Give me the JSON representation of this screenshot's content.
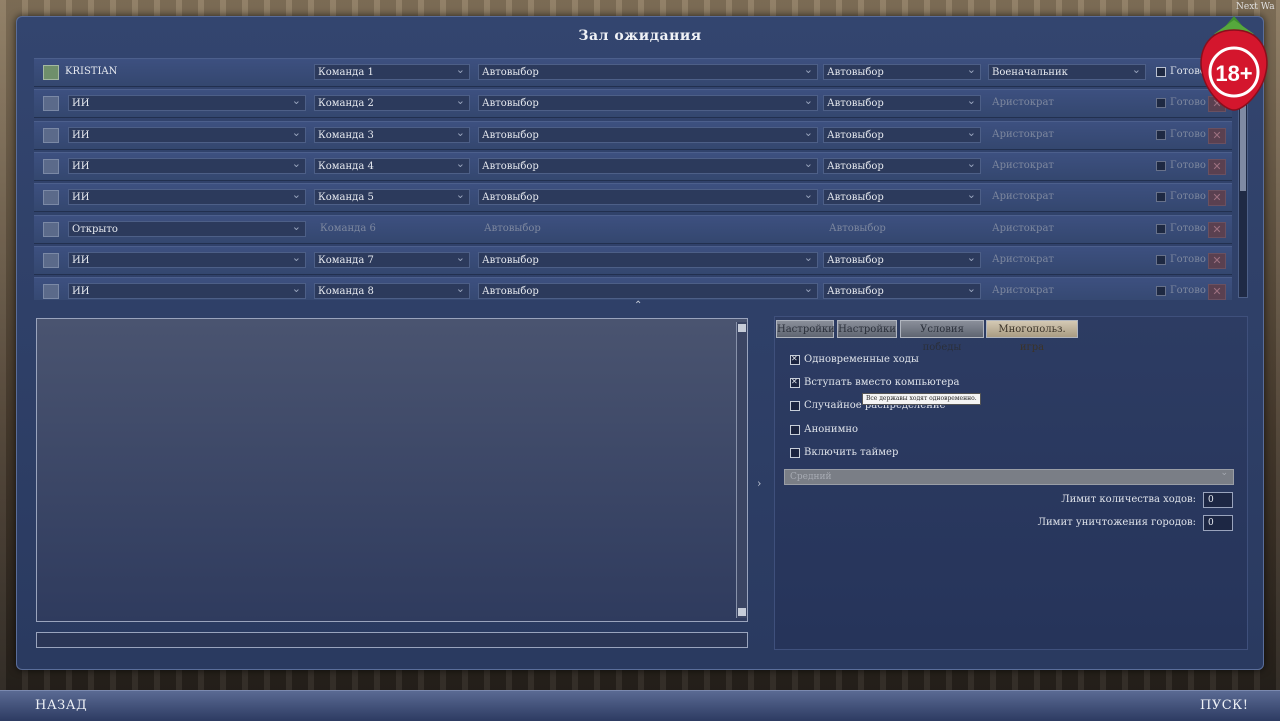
{
  "window": {
    "title": "Зал ожидания"
  },
  "corner_text": "Next Wa",
  "age_badge": "18+",
  "players": [
    {
      "name": "KRISTIAN",
      "team": "Команда 1",
      "civ": "Автовыбор",
      "leader": "Автовыбор",
      "difficulty": "Военачальник",
      "ready": "Готово",
      "is_self": true,
      "open": false
    },
    {
      "name": "ИИ",
      "team": "Команда 2",
      "civ": "Автовыбор",
      "leader": "Автовыбор",
      "difficulty": "Аристократ",
      "ready": "Готово",
      "is_self": false,
      "open": false
    },
    {
      "name": "ИИ",
      "team": "Команда 3",
      "civ": "Автовыбор",
      "leader": "Автовыбор",
      "difficulty": "Аристократ",
      "ready": "Готово",
      "is_self": false,
      "open": false
    },
    {
      "name": "ИИ",
      "team": "Команда 4",
      "civ": "Автовыбор",
      "leader": "Автовыбор",
      "difficulty": "Аристократ",
      "ready": "Готово",
      "is_self": false,
      "open": false
    },
    {
      "name": "ИИ",
      "team": "Команда 5",
      "civ": "Автовыбор",
      "leader": "Автовыбор",
      "difficulty": "Аристократ",
      "ready": "Готово",
      "is_self": false,
      "open": false
    },
    {
      "name": "Открыто",
      "team": "Команда 6",
      "civ": "Автовыбор",
      "leader": "Автовыбор",
      "difficulty": "Аристократ",
      "ready": "Готово",
      "is_self": false,
      "open": true
    },
    {
      "name": "ИИ",
      "team": "Команда 7",
      "civ": "Автовыбор",
      "leader": "Автовыбор",
      "difficulty": "Аристократ",
      "ready": "Готово",
      "is_self": false,
      "open": false
    },
    {
      "name": "ИИ",
      "team": "Команда 8",
      "civ": "Автовыбор",
      "leader": "Автовыбор",
      "difficulty": "Аристократ",
      "ready": "Готово",
      "is_self": false,
      "open": false
    }
  ],
  "tabs": [
    {
      "label": "Настройки",
      "active": false
    },
    {
      "label": "Настройки",
      "active": false
    },
    {
      "label": "Условия победы",
      "active": false
    },
    {
      "label": "Многопольз. игра",
      "active": true
    }
  ],
  "options": [
    {
      "label": "Одновременные ходы",
      "checked": true
    },
    {
      "label": "Вступать вместо компьютера",
      "checked": true
    },
    {
      "label": "Случайное распределение",
      "checked": false
    },
    {
      "label": "Анонимно",
      "checked": false
    },
    {
      "label": "Включить таймер",
      "checked": false
    }
  ],
  "tooltip": "Все державы ходят одновременно.",
  "timer_speed": "Средний",
  "limits": {
    "turns_label": "Лимит количества ходов:",
    "turns_value": "0",
    "cities_label": "Лимит уничтожения городов:",
    "cities_value": "0"
  },
  "bottom": {
    "back": "НАЗАД",
    "start": "ПУСК!"
  }
}
